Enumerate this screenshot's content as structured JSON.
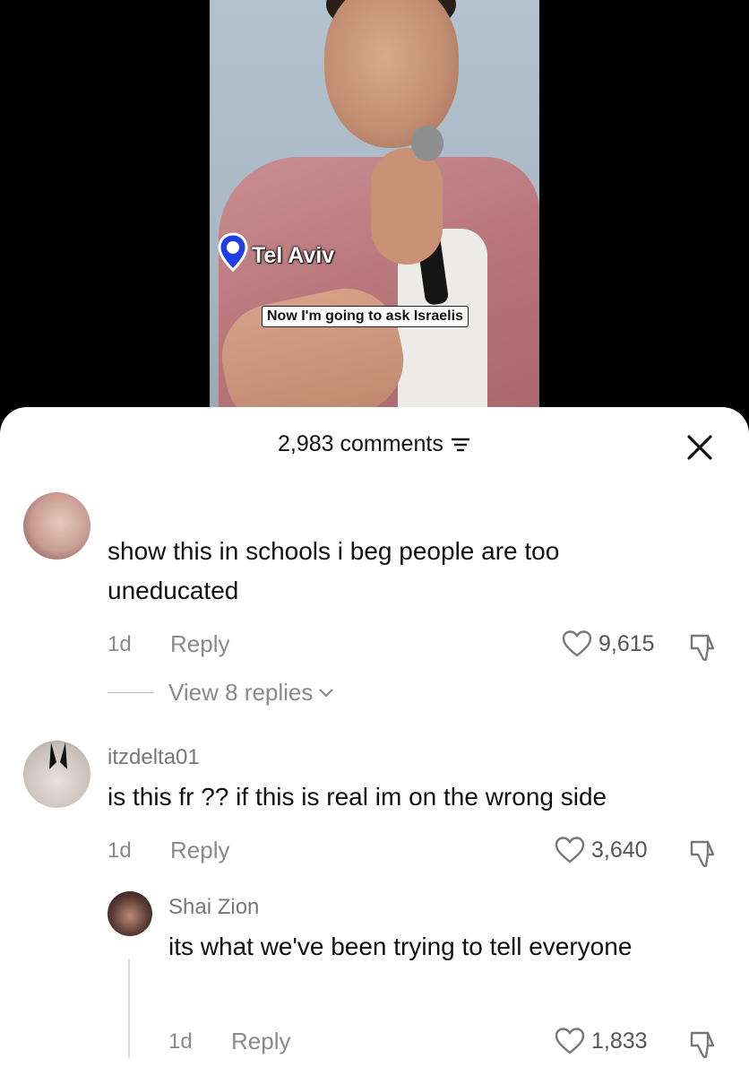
{
  "video": {
    "location": "Tel Aviv",
    "caption": "Now I'm going to ask Israelis"
  },
  "sheet": {
    "comments_count": "2,983 comments"
  },
  "comments": [
    {
      "username": "",
      "text": "show this in schools i beg people are too uneducated",
      "age": "1d",
      "reply_label": "Reply",
      "likes": "9,615",
      "view_replies": "View 8 replies"
    },
    {
      "username": "itzdelta01",
      "text": "is this fr ?? if this is real im on the wrong side",
      "age": "1d",
      "reply_label": "Reply",
      "likes": "3,640"
    }
  ],
  "reply": {
    "username": "Shai Zion",
    "text": "its what we've been trying to tell everyone",
    "age": "1d",
    "reply_label": "Reply",
    "likes": "1,833"
  },
  "colors": {
    "pin_blue": "#1f3ee6",
    "muted_text": "#8a8a8a",
    "sheet_bg": "#ffffff"
  }
}
